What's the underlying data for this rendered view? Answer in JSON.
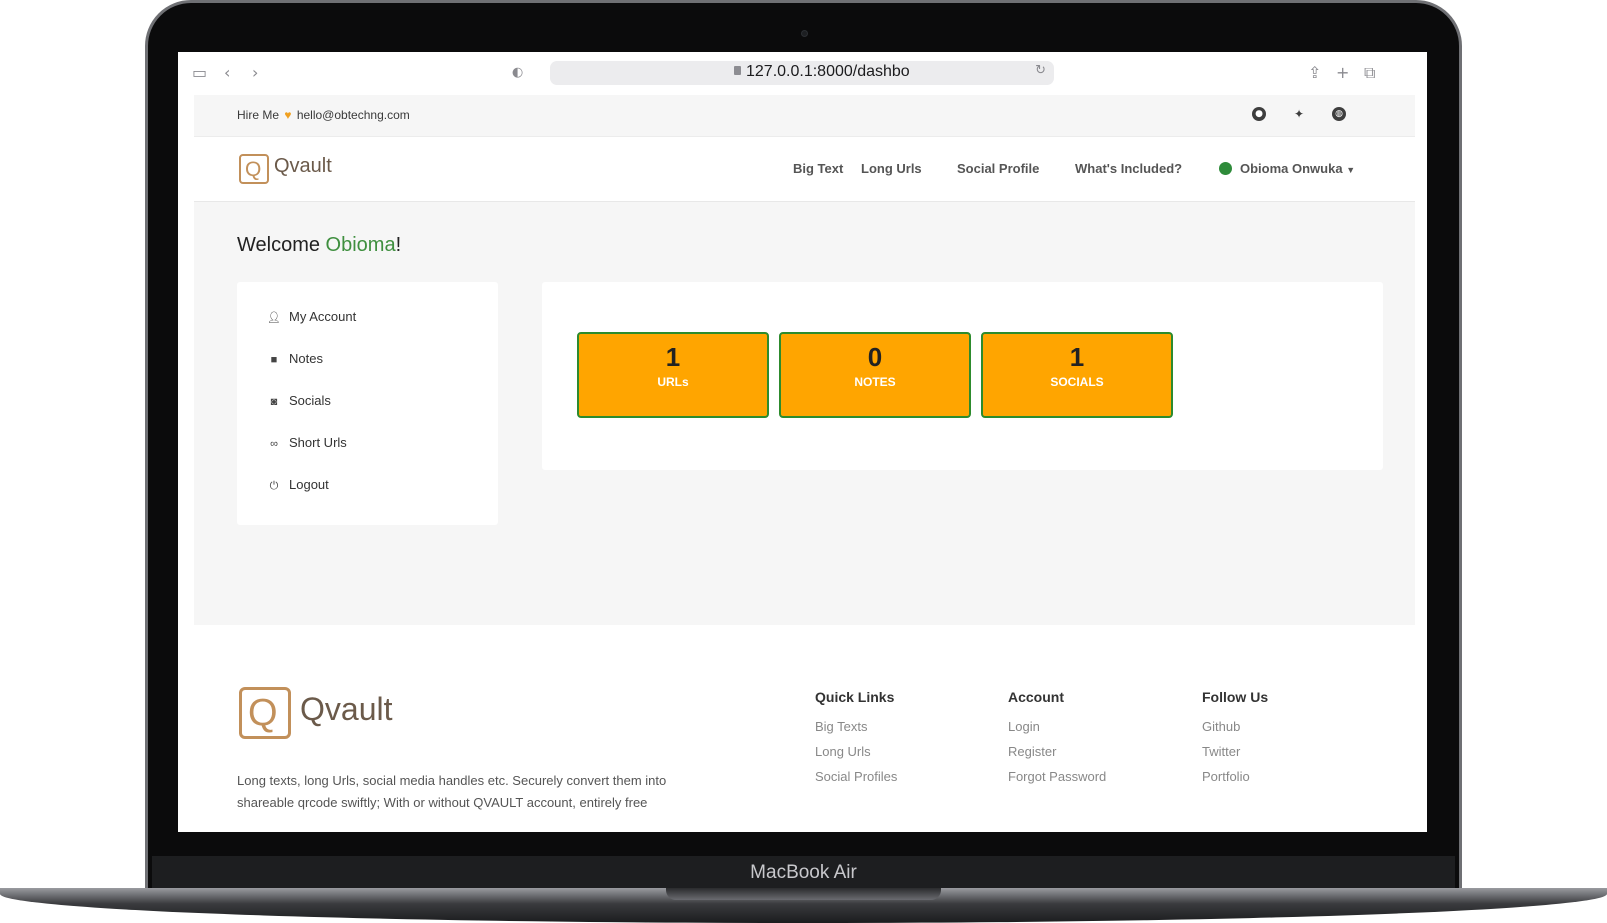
{
  "device": {
    "label": "MacBook Air"
  },
  "browser": {
    "url": "127.0.0.1:8000/dashbo",
    "icons": [
      "sidebar-icon",
      "back-icon",
      "forward-icon",
      "shield-icon",
      "reload-icon",
      "share-icon",
      "new-tab-icon",
      "tabs-icon"
    ]
  },
  "topbar": {
    "hire_label": "Hire Me",
    "email": "hello@obtechng.com",
    "social_icons": [
      "github-icon",
      "twitter-icon",
      "globe-icon"
    ]
  },
  "navbar": {
    "brand": "Qvault",
    "brand_letter": "Q",
    "links": [
      "Big Text",
      "Long Urls",
      "Social Profile",
      "What's Included?"
    ],
    "user_name": "Obioma Onwuka"
  },
  "welcome": {
    "prefix": "Welcome ",
    "name": "Obioma",
    "suffix": "!"
  },
  "sidebar": {
    "items": [
      {
        "label": "My Account",
        "icon": "user-icon"
      },
      {
        "label": "Notes",
        "icon": "note-icon"
      },
      {
        "label": "Socials",
        "icon": "instagram-icon"
      },
      {
        "label": "Short Urls",
        "icon": "link-icon"
      },
      {
        "label": "Logout",
        "icon": "power-icon"
      }
    ]
  },
  "stats": [
    {
      "value": "1",
      "label": "URLs"
    },
    {
      "value": "0",
      "label": "NOTES"
    },
    {
      "value": "1",
      "label": "SOCIALS"
    }
  ],
  "footer": {
    "brand": "Qvault",
    "brand_letter": "Q",
    "description": "Long texts, long Urls, social media handles etc. Securely convert them into shareable qrcode swiftly; With or without QVAULT account, entirely free",
    "columns": [
      {
        "title": "Quick Links",
        "links": [
          "Big Texts",
          "Long Urls",
          "Social Profiles"
        ]
      },
      {
        "title": "Account",
        "links": [
          "Login",
          "Register",
          "Forgot Password"
        ]
      },
      {
        "title": "Follow Us",
        "links": [
          "Github",
          "Twitter",
          "Portfolio"
        ]
      }
    ]
  },
  "colors": {
    "accent_green": "#3f8f3f",
    "stat_orange": "#ffa500",
    "stat_border": "#2d8b2d",
    "logo_gold": "#c2905a"
  }
}
